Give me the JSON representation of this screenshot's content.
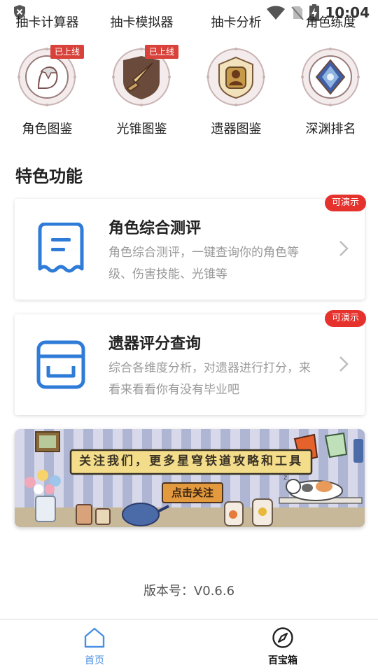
{
  "status_bar": {
    "time": "10:04"
  },
  "tool_row": [
    {
      "label": "抽卡计算器"
    },
    {
      "label": "抽卡模拟器"
    },
    {
      "label": "抽卡分析"
    },
    {
      "label": "角色练度"
    }
  ],
  "guide_row": [
    {
      "label": "角色图鉴",
      "badge": "已上线",
      "icon": "character-icon"
    },
    {
      "label": "光锥图鉴",
      "badge": "已上线",
      "icon": "sword-icon"
    },
    {
      "label": "遗器图鉴",
      "badge": "",
      "icon": "relic-icon"
    },
    {
      "label": "深渊排名",
      "badge": "",
      "icon": "abyss-icon"
    }
  ],
  "section_title": "特色功能",
  "features": [
    {
      "title": "角色综合测评",
      "desc": "角色综合测评，一键查询你的角色等级、伤害技能、光锥等",
      "badge": "可演示",
      "icon": "receipt-icon"
    },
    {
      "title": "遗器评分查询",
      "desc": "综合各维度分析，对遗器进行打分，来看来看看你有没有毕业吧",
      "badge": "可演示",
      "icon": "inbox-icon"
    }
  ],
  "banner": {
    "text": "关注我们，更多星穹铁道攻略和工具",
    "button": "点击关注"
  },
  "version": "版本号：V0.6.6",
  "bottom_nav": [
    {
      "label": "首页",
      "icon": "home-icon"
    },
    {
      "label": "百宝箱",
      "icon": "compass-icon"
    }
  ],
  "colors": {
    "accent": "#4a90e2",
    "badge_red": "#e5322d",
    "icon_blue": "#2f7bd8"
  }
}
